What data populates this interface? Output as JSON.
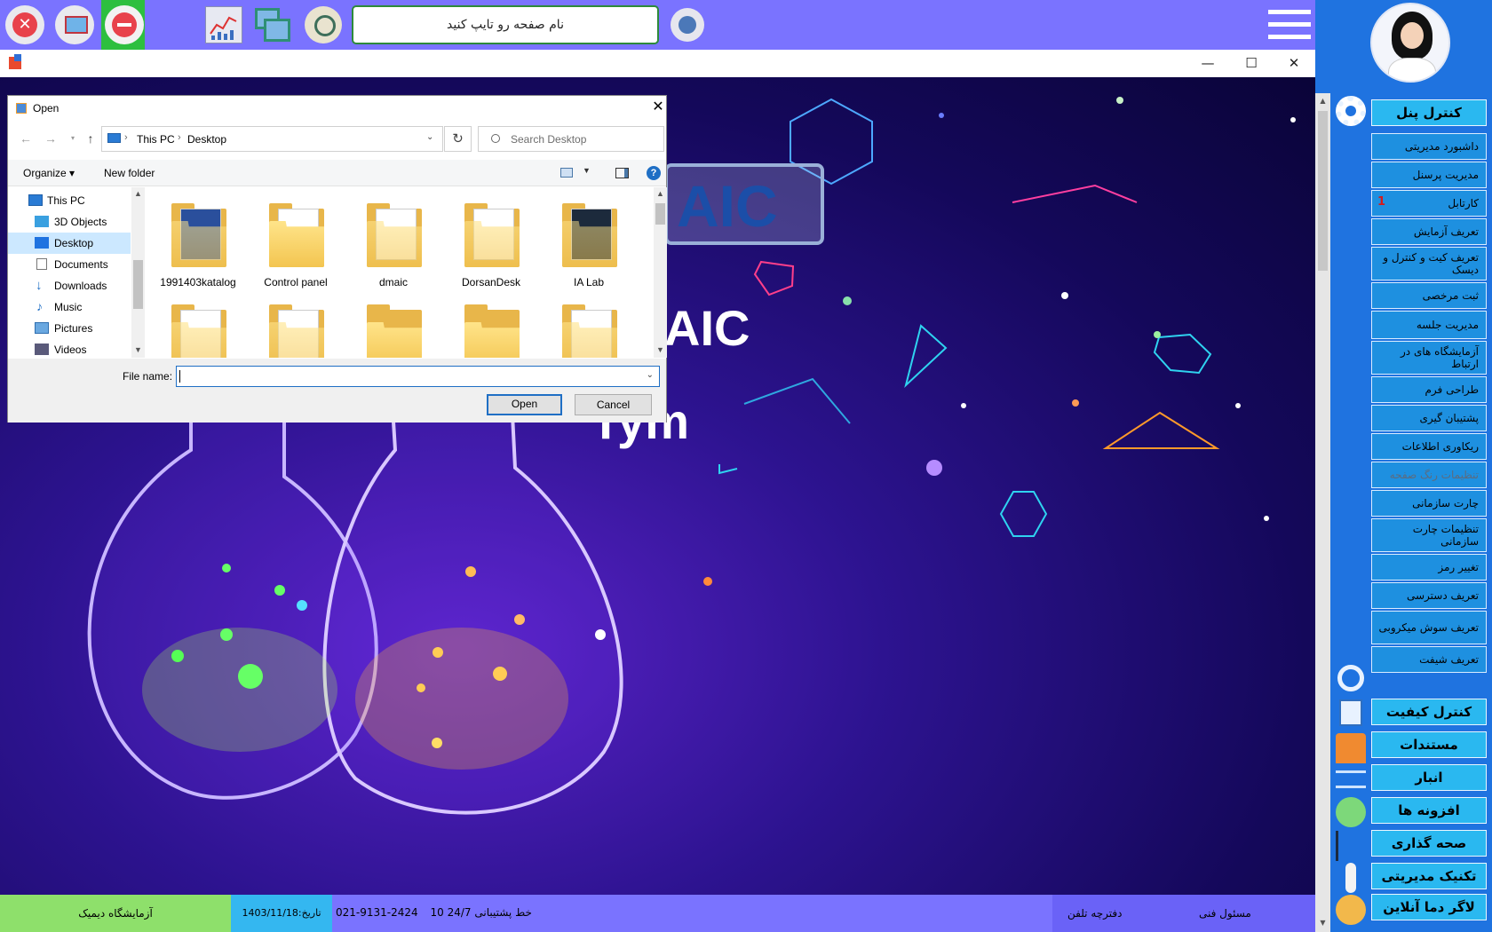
{
  "topbar": {
    "page_input_placeholder": "نام صفحه رو تایپ کنید",
    "icons": [
      "close-icon",
      "monitor-icon",
      "minimize-icon",
      "chart-icon",
      "windows-icon",
      "search-icon",
      "go-icon",
      "hamburger-icon"
    ]
  },
  "window": {
    "controls": {
      "minimize": "—",
      "maximize": "☐",
      "close": "✕"
    }
  },
  "art": {
    "logo_box_text": "AIC",
    "logo_text": "AIC",
    "bottom_text": "Tym"
  },
  "dialog": {
    "title": "Open",
    "close": "✕",
    "address": {
      "root": "This PC",
      "current": "Desktop"
    },
    "search_placeholder": "Search Desktop",
    "toolbar": {
      "organize": "Organize ▾",
      "new_folder": "New folder",
      "help": "?"
    },
    "nav_items": [
      "This PC",
      "3D Objects",
      "Desktop",
      "Documents",
      "Downloads",
      "Music",
      "Pictures",
      "Videos"
    ],
    "selected_nav": "Desktop",
    "files": [
      "1991403katalog",
      "Control panel",
      "dmaic",
      "DorsanDesk",
      "IA Lab"
    ],
    "file_name_label": "File name:",
    "file_name_value": "",
    "open_button": "Open",
    "cancel_button": "Cancel"
  },
  "sidebar": {
    "sections": [
      {
        "label": "کنترل پنل",
        "icon": "gear-icon"
      },
      {
        "label": "کنترل کیفیت",
        "icon": "quality-icon"
      },
      {
        "label": "مستندات",
        "icon": "document-icon"
      },
      {
        "label": "انبار",
        "icon": "warehouse-icon"
      },
      {
        "label": "افزونه ها",
        "icon": "plugin-icon"
      },
      {
        "label": "صحه گذاری",
        "icon": "check-icon"
      },
      {
        "label": "تکنیک مدیریتی",
        "icon": "management-icon"
      },
      {
        "label": "لاگر دما آنلاین",
        "icon": "thermometer-icon"
      }
    ],
    "menu_items": [
      {
        "label": "داشبورد مدیریتی"
      },
      {
        "label": "مدیریت پرسنل"
      },
      {
        "label": "کارتابل",
        "badge": "1"
      },
      {
        "label": "تعریف آزمایش"
      },
      {
        "label": "تعریف کیت و کنترل و دیسک"
      },
      {
        "label": "ثبت مرخصی"
      },
      {
        "label": "مدیریت جلسه"
      },
      {
        "label": "آزمایشگاه های در ارتباط"
      },
      {
        "label": "طراحی فرم"
      },
      {
        "label": "پشتیبان گیری"
      },
      {
        "label": "ریکاوری اطلاعات"
      },
      {
        "label": "تنظیمات رنگ صفحه"
      },
      {
        "label": "چارت سازمانی"
      },
      {
        "label": "تنظیمات چارت سازمانی"
      },
      {
        "label": "تغییر رمز"
      },
      {
        "label": "تعریف دسترسی"
      },
      {
        "label": "تعریف سوش میکروبی"
      },
      {
        "label": "تعریف شیفت"
      }
    ]
  },
  "statusbar": {
    "lab_name": "آزمایشگاه دیمیک",
    "date": "تاریخ:1403/11/18",
    "phone": "021-9131-2424",
    "lines": "10 خط",
    "support": "پشتیبانی 24/7",
    "phonebook": "دفترچه تلفن",
    "technical_manager": "مسئول فنی"
  }
}
